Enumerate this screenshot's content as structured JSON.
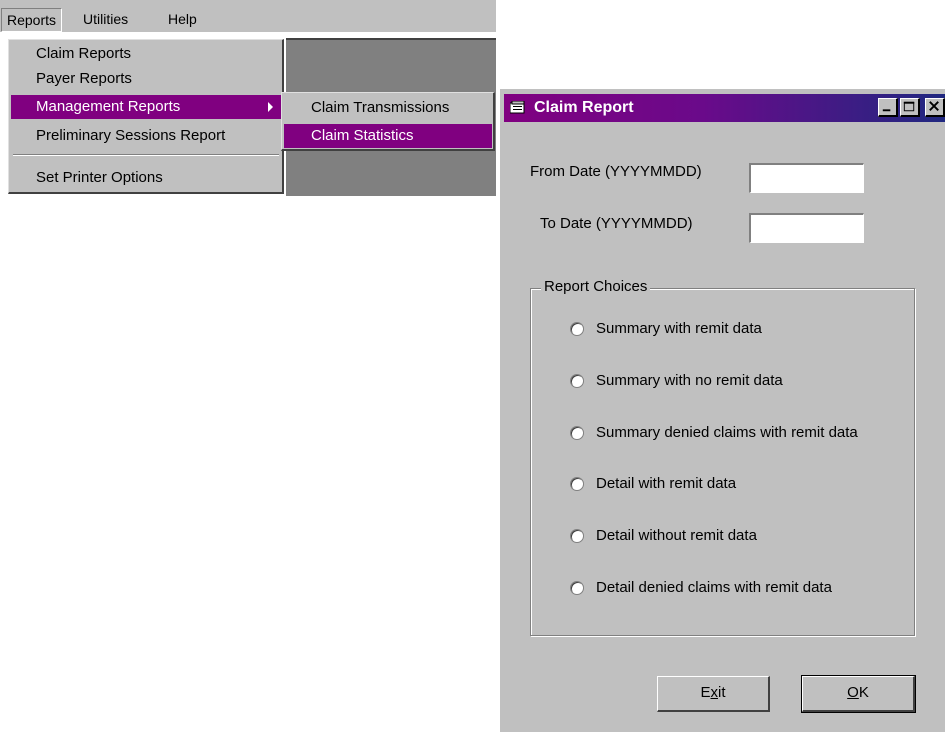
{
  "menubar": {
    "items": [
      {
        "label": "Reports"
      },
      {
        "label": "Utilities"
      },
      {
        "label": "Help"
      }
    ]
  },
  "reports_menu": {
    "items": [
      {
        "label": "Claim Reports"
      },
      {
        "label": "Payer Reports"
      },
      {
        "label": "Management Reports"
      },
      {
        "label": "Preliminary Sessions Report"
      },
      {
        "label": "Set Printer Options"
      }
    ]
  },
  "management_submenu": {
    "items": [
      {
        "label": "Claim Transmissions"
      },
      {
        "label": "Claim Statistics"
      }
    ]
  },
  "dialog": {
    "title": "Claim Report",
    "from_date_label": "From Date (YYYYMMDD)",
    "from_date_value": "",
    "to_date_label": "To Date (YYYYMMDD)",
    "to_date_value": "",
    "group_label": "Report Choices",
    "choices": [
      {
        "label": "Summary with remit data"
      },
      {
        "label": "Summary with no remit data"
      },
      {
        "label": "Summary denied claims with remit data"
      },
      {
        "label": "Detail with remit data"
      },
      {
        "label": "Detail without remit data"
      },
      {
        "label": "Detail denied claims with remit data"
      }
    ],
    "exit_label_pre": "E",
    "exit_label_u": "x",
    "exit_label_post": "it",
    "ok_label_u": "O",
    "ok_label_post": "K"
  },
  "colors": {
    "menu_highlight": "#800080",
    "window_face": "#c0c0c0",
    "title_gradient_start": "#800080",
    "title_gradient_end": "#202880"
  }
}
